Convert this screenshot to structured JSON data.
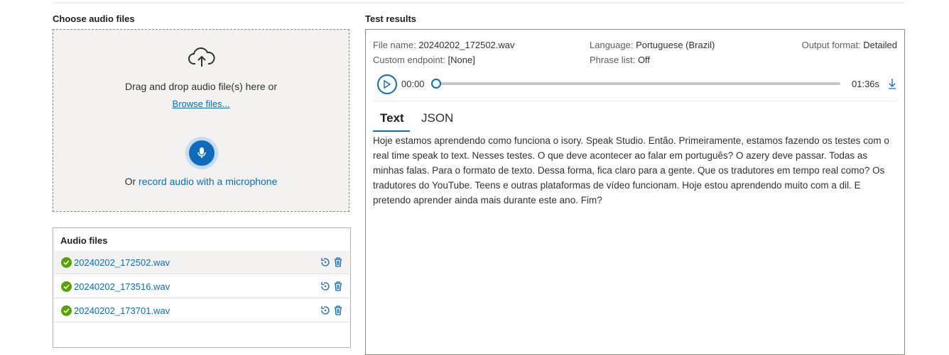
{
  "left": {
    "title": "Choose audio files",
    "dropzone": {
      "line1": "Drag and drop audio file(s) here or",
      "browse": "Browse files...",
      "record_prefix": "Or ",
      "record_link": "record audio with a microphone"
    },
    "audio_files": {
      "header": "Audio files",
      "items": [
        {
          "name": "20240202_172502.wav"
        },
        {
          "name": "20240202_173516.wav"
        },
        {
          "name": "20240202_173701.wav"
        }
      ]
    }
  },
  "results": {
    "title": "Test results",
    "file_name_label": "File name:",
    "file_name": "20240202_172502.wav",
    "endpoint_label": "Custom endpoint:",
    "endpoint": "[None]",
    "language_label": "Language:",
    "language": "Portuguese (Brazil)",
    "phrase_label": "Phrase list:",
    "phrase": "Off",
    "format_label": "Output format:",
    "format": "Detailed",
    "player": {
      "current": "00:00",
      "duration": "01:36s",
      "progress": 0
    },
    "tabs": [
      {
        "label": "Text"
      },
      {
        "label": "JSON"
      }
    ],
    "transcript": "Hoje estamos aprendendo como funciona o isory. Speak Studio. Então. Primeiramente, estamos fazendo os testes com o real time speak to text. Nesses testes. O que deve acontecer ao falar em português? O azery deve passar. Todas as minhas falas. Para o formato de texto. Dessa forma, fica claro para a gente. Que os tradutores em tempo real como? Os tradutores do YouTube. Teens e outras plataformas de vídeo funcionam. Hoje estou aprendendo muito com a dil. E pretendo aprender ainda mais durante este ano. Fim?"
  },
  "colors": {
    "accent": "#0f6cbd",
    "success": "#57a300"
  },
  "icons": [
    "cloud-upload-icon",
    "microphone-icon",
    "check-circle-icon",
    "rerun-icon",
    "delete-icon",
    "play-icon",
    "download-icon"
  ]
}
